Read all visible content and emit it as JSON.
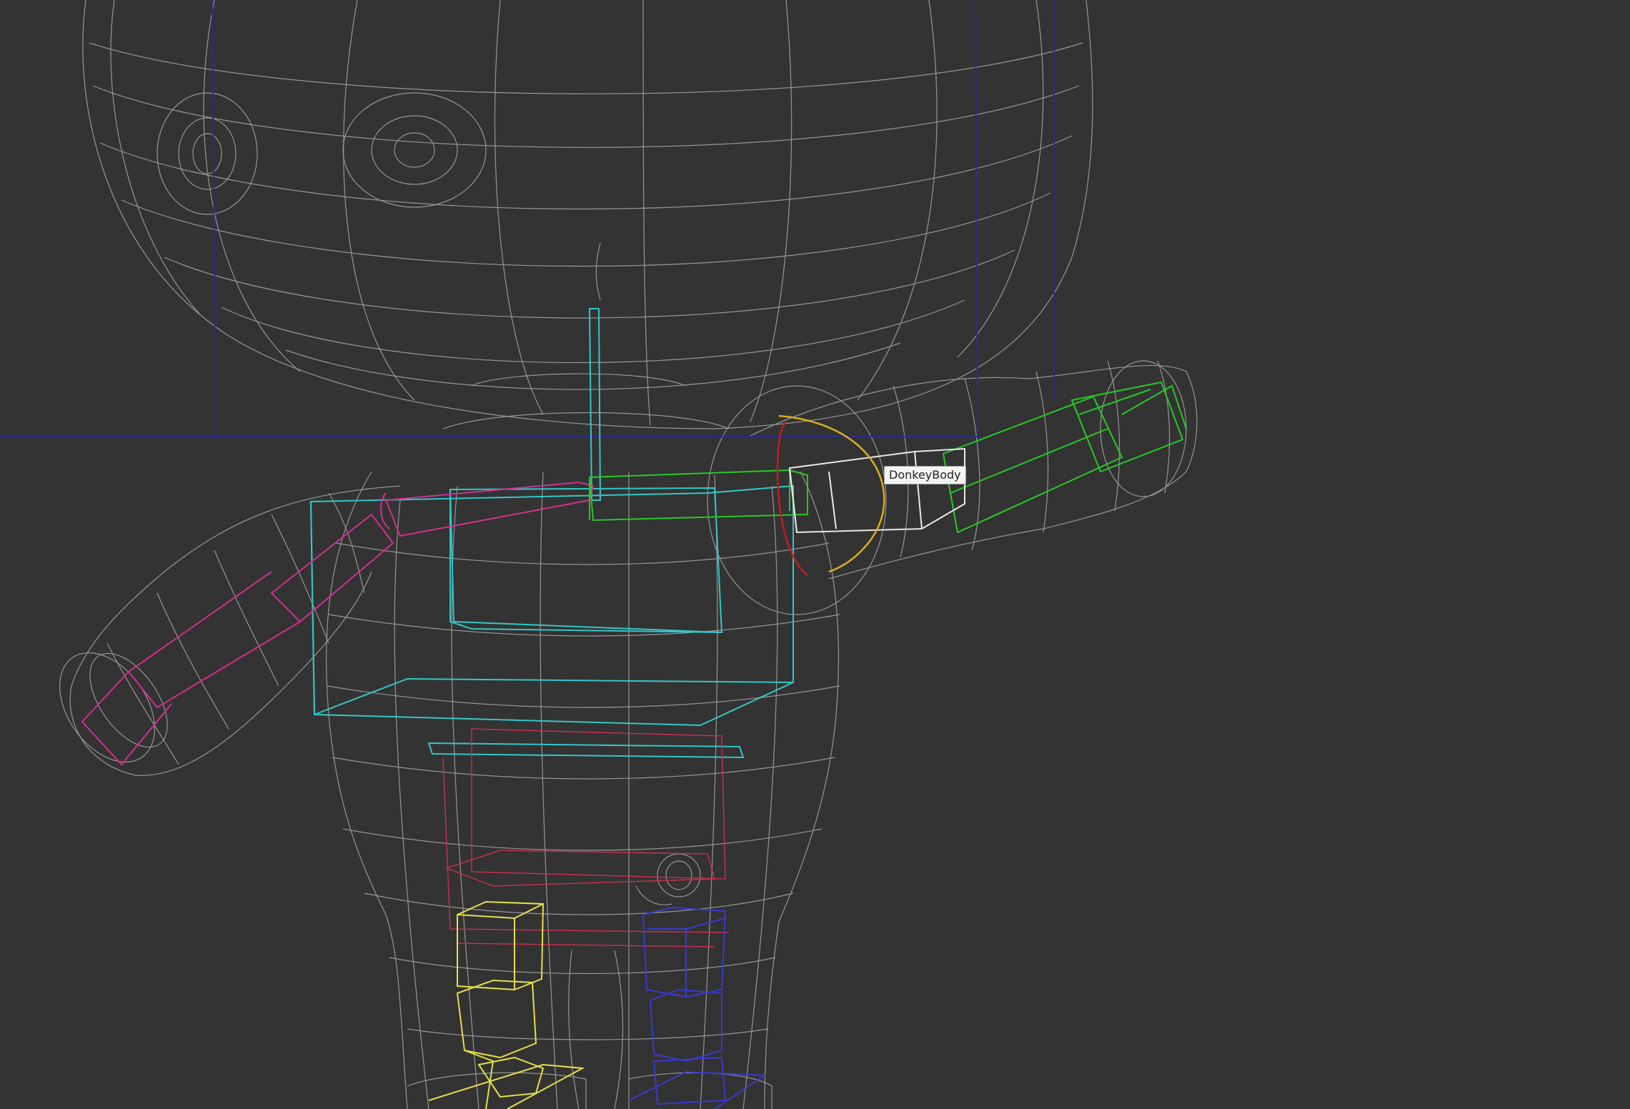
{
  "viewport": {
    "background": "#333333",
    "mesh_color": "#a8a8a8",
    "hover_tooltip": "DonkeyBody"
  },
  "rig_colors": {
    "spine": "#35c6c6",
    "left_arm": "#d0308c",
    "right_arm": "#28c828",
    "left_leg": "#e6e04a",
    "right_leg": "#3a3ad0",
    "pelvis": "#c03050",
    "guides": "#2b2b8a",
    "gizmo_yellow": "#d8b020",
    "gizmo_red": "#c02020"
  }
}
